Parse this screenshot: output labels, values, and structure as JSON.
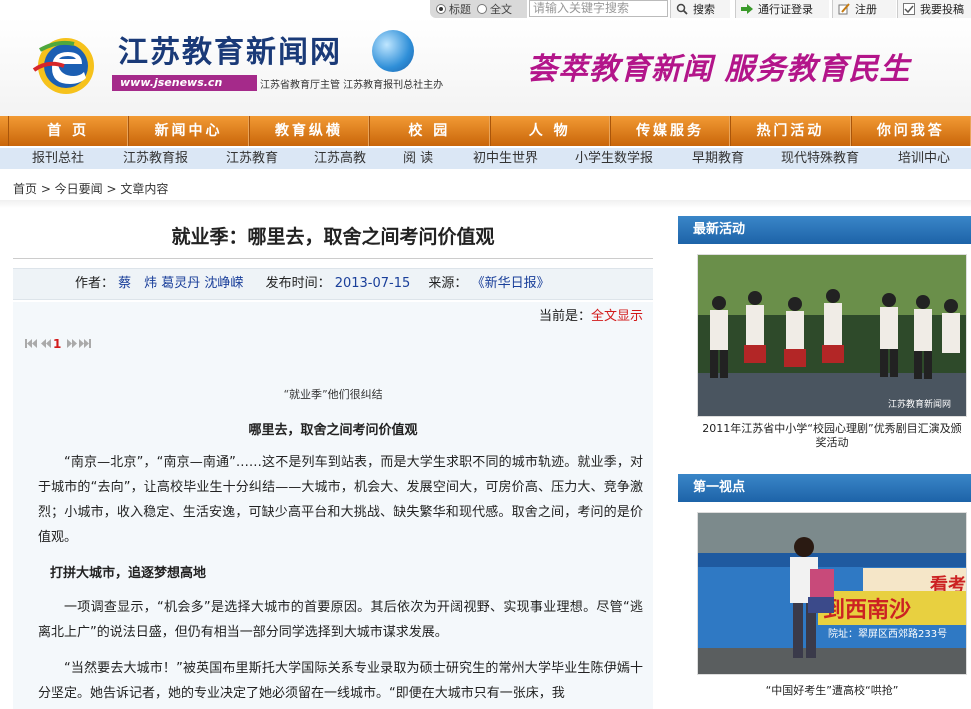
{
  "topbar": {
    "radio_title": "标题",
    "radio_fulltext": "全文",
    "search_placeholder": "请输入关键字搜索",
    "search_btn": "搜索",
    "passport_btn": "通行证登录",
    "register_btn": "注册",
    "submit_btn": "我要投稿"
  },
  "header": {
    "site_name": "江苏教育新闻网",
    "url": "www.jsenews.cn",
    "sponsor": "江苏省教育厅主管 江苏教育报刊总社主办",
    "slogan": "荟萃教育新闻  服务教育民生"
  },
  "mainnav": [
    "首 页",
    "新闻中心",
    "教育纵横",
    "校 园",
    "人 物",
    "传媒服务",
    "热门活动",
    "你问我答"
  ],
  "subnav": [
    "报刊总社",
    "江苏教育报",
    "江苏教育",
    "江苏高教",
    "阅 读",
    "初中生世界",
    "小学生数学报",
    "早期教育",
    "现代特殊教育",
    "培训中心"
  ],
  "breadcrumb": "首页 > 今日要闻 > 文章内容",
  "article": {
    "title": "就业季：哪里去，取舍之间考问价值观",
    "author_label": "作者：",
    "author": "蔡　炜 葛灵丹 沈峥嵘",
    "time_label": "发布时间：",
    "time": "2013-07-15",
    "source_label": "来源：",
    "source": "《新华日报》",
    "current_label": "当前是：",
    "current_value": "全文显示",
    "page_num": "1",
    "caption": "“就业季”他们很纠结",
    "subhead": "哪里去，取舍之间考问价值观",
    "p1": "“南京—北京”，“南京—南通”……这不是列车到站表，而是大学生求职不同的城市轨迹。就业季，对于城市的“去向”，让高校毕业生十分纠结——大城市，机会大、发展空间大，可房价高、压力大、竞争激烈；小城市，收入稳定、生活安逸，可缺少高平台和大挑战、缺失繁华和现代感。取舍之间，考问的是价值观。",
    "h1": "打拼大城市，追逐梦想高地",
    "p2": "一项调查显示，“机会多”是选择大城市的首要原因。其后依次为开阔视野、实现事业理想。尽管“逃离北上广”的说法日盛，但仍有相当一部分同学选择到大城市谋求发展。",
    "p3": "“当然要去大城市！”被英国布里斯托大学国际关系专业录取为硕士研究生的常州大学毕业生陈伊嫣十分坚定。她告诉记者，她的专业决定了她必须留在一线城市。“即便在大城市只有一张床，我"
  },
  "sidebar": {
    "latest_head": "最新活动",
    "latest_caption": "2011年江苏省中小学“校园心理剧”优秀剧目汇演及颁奖活动",
    "view_head": "第一视点",
    "view_caption": "“中国好考生”遭高校“哄抢”",
    "bus_sign1": "看考",
    "bus_sign2": "到西南沙",
    "bus_sign3": "院址：翠屏区西郊路233号",
    "watermark": "江苏教育新闻网"
  }
}
